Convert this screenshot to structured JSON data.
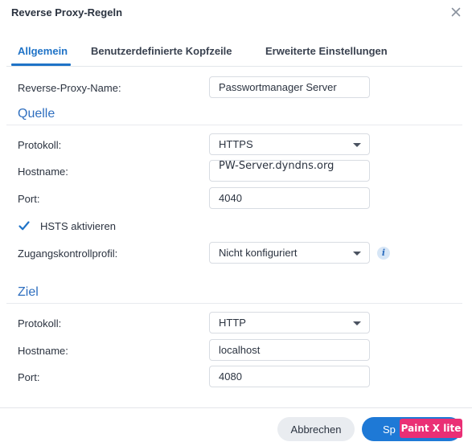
{
  "window": {
    "title": "Reverse Proxy-Regeln"
  },
  "tabs": [
    {
      "label": "Allgemein",
      "active": true
    },
    {
      "label": "Benutzerdefinierte Kopfzeile",
      "active": false
    },
    {
      "label": "Erweiterte Einstellungen",
      "active": false
    }
  ],
  "general": {
    "name_label": "Reverse-Proxy-Name:",
    "name_value": "Passwortmanager Server"
  },
  "source": {
    "heading": "Quelle",
    "protocol_label": "Protokoll:",
    "protocol_value": "HTTPS",
    "hostname_label": "Hostname:",
    "hostname_value": "PW-Server.dyndns.org",
    "port_label": "Port:",
    "port_value": "4040",
    "hsts_label": "HSTS aktivieren",
    "hsts_checked": true,
    "access_label": "Zugangskontrollprofil:",
    "access_value": "Nicht konfiguriert",
    "info_icon": "i"
  },
  "destination": {
    "heading": "Ziel",
    "protocol_label": "Protokoll:",
    "protocol_value": "HTTP",
    "hostname_label": "Hostname:",
    "hostname_value": "localhost",
    "port_label": "Port:",
    "port_value": "4080"
  },
  "footer": {
    "cancel_label": "Abbrechen",
    "save_label": "Sp"
  },
  "watermark": {
    "text": "Paint X lite"
  },
  "colors": {
    "accent": "#1f73c7",
    "primary_button": "#1e79d6",
    "watermark_bg": "#ea2f75"
  }
}
